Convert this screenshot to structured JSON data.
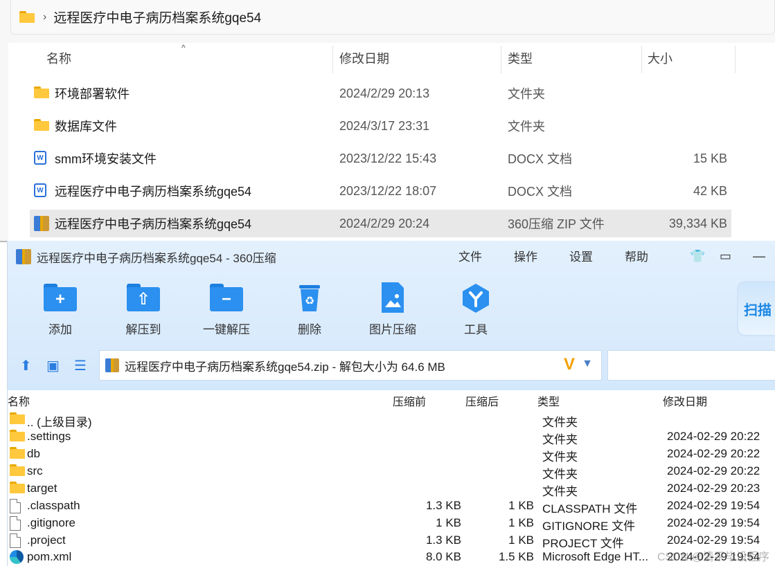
{
  "explorer": {
    "breadcrumb": "远程医疗中电子病历档案系统gqe54",
    "columns": {
      "name": "名称",
      "date": "修改日期",
      "type": "类型",
      "size": "大小"
    },
    "rows": [
      {
        "name": "环境部署软件",
        "date": "2024/2/29 20:13",
        "type": "文件夹",
        "size": "",
        "icon": "folder-icon"
      },
      {
        "name": "数据库文件",
        "date": "2024/3/17 23:31",
        "type": "文件夹",
        "size": "",
        "icon": "folder-icon"
      },
      {
        "name": "smm环境安装文件",
        "date": "2023/12/22 15:43",
        "type": "DOCX 文档",
        "size": "15 KB",
        "icon": "wps-doc-icon"
      },
      {
        "name": "远程医疗中电子病历档案系统gqe54",
        "date": "2023/12/22 18:07",
        "type": "DOCX 文档",
        "size": "42 KB",
        "icon": "wps-doc-icon"
      },
      {
        "name": "远程医疗中电子病历档案系统gqe54",
        "date": "2024/2/29 20:24",
        "type": "360压缩 ZIP 文件",
        "size": "39,334 KB",
        "icon": "zip-icon"
      }
    ]
  },
  "zip": {
    "title": "远程医疗中电子病历档案系统gqe54 - 360压缩",
    "menu": [
      "文件",
      "操作",
      "设置",
      "帮助"
    ],
    "tools": [
      "添加",
      "解压到",
      "一键解压",
      "删除",
      "图片压缩",
      "工具"
    ],
    "scan_label": "扫描",
    "path": "远程医疗中电子病历档案系统gqe54.zip - 解包大小为 64.6 MB",
    "columns": {
      "name": "名称",
      "compressed_before": "压缩前",
      "compressed_after": "压缩后",
      "type": "类型",
      "date": "修改日期"
    },
    "rows": [
      {
        "name": ".. (上级目录)",
        "csize": "",
        "psize": "",
        "type": "文件夹",
        "date": "",
        "icon": "folder-icon"
      },
      {
        "name": ".settings",
        "csize": "",
        "psize": "",
        "type": "文件夹",
        "date": "2024-02-29 20:22",
        "icon": "folder-icon"
      },
      {
        "name": "db",
        "csize": "",
        "psize": "",
        "type": "文件夹",
        "date": "2024-02-29 20:22",
        "icon": "folder-icon"
      },
      {
        "name": "src",
        "csize": "",
        "psize": "",
        "type": "文件夹",
        "date": "2024-02-29 20:22",
        "icon": "folder-icon"
      },
      {
        "name": "target",
        "csize": "",
        "psize": "",
        "type": "文件夹",
        "date": "2024-02-29 20:23",
        "icon": "folder-icon"
      },
      {
        "name": ".classpath",
        "csize": "1.3 KB",
        "psize": "1 KB",
        "type": "CLASSPATH 文件",
        "date": "2024-02-29 19:54",
        "icon": "file-icon"
      },
      {
        "name": ".gitignore",
        "csize": "1 KB",
        "psize": "1 KB",
        "type": "GITIGNORE 文件",
        "date": "2024-02-29 19:54",
        "icon": "file-icon"
      },
      {
        "name": ".project",
        "csize": "1.3 KB",
        "psize": "1 KB",
        "type": "PROJECT 文件",
        "date": "2024-02-29 19:54",
        "icon": "file-icon"
      },
      {
        "name": "pom.xml",
        "csize": "8.0 KB",
        "psize": "1.5 KB",
        "type": "Microsoft Edge HT...",
        "date": "2024-02-29 19:54",
        "icon": "edge-icon"
      }
    ]
  },
  "watermark": "CSDN @清平毕设程序"
}
